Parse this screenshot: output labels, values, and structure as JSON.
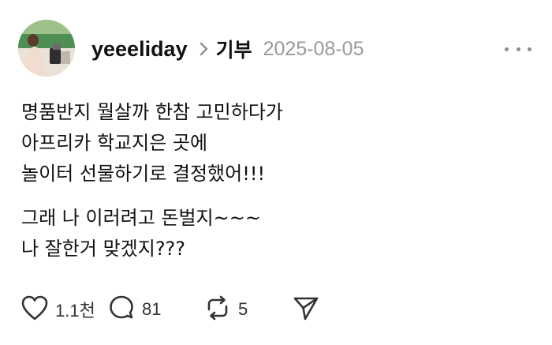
{
  "post": {
    "username": "yeeeliday",
    "category": "기부",
    "date": "2025-08-05",
    "avatar_icon": "profile-photo",
    "more_icon": "more-horizontal-icon",
    "paragraphs": [
      [
        "명품반지 뭘살까 한참 고민하다가",
        "아프리카 학교지은 곳에",
        "놀이터 선물하기로 결정했어!!!"
      ],
      [
        "그래 나 이러려고 돈벌지~~~",
        "나 잘한거 맞겠지???"
      ]
    ]
  },
  "actions": {
    "like": {
      "icon": "heart-icon",
      "count": "1.1천"
    },
    "comment": {
      "icon": "comment-bubble-icon",
      "count": "81"
    },
    "repost": {
      "icon": "repost-icon",
      "count": "5"
    },
    "share": {
      "icon": "send-icon"
    }
  },
  "colors": {
    "text": "#111111",
    "muted": "#9a9a9a",
    "icon": "#333333",
    "background": "#ffffff"
  }
}
